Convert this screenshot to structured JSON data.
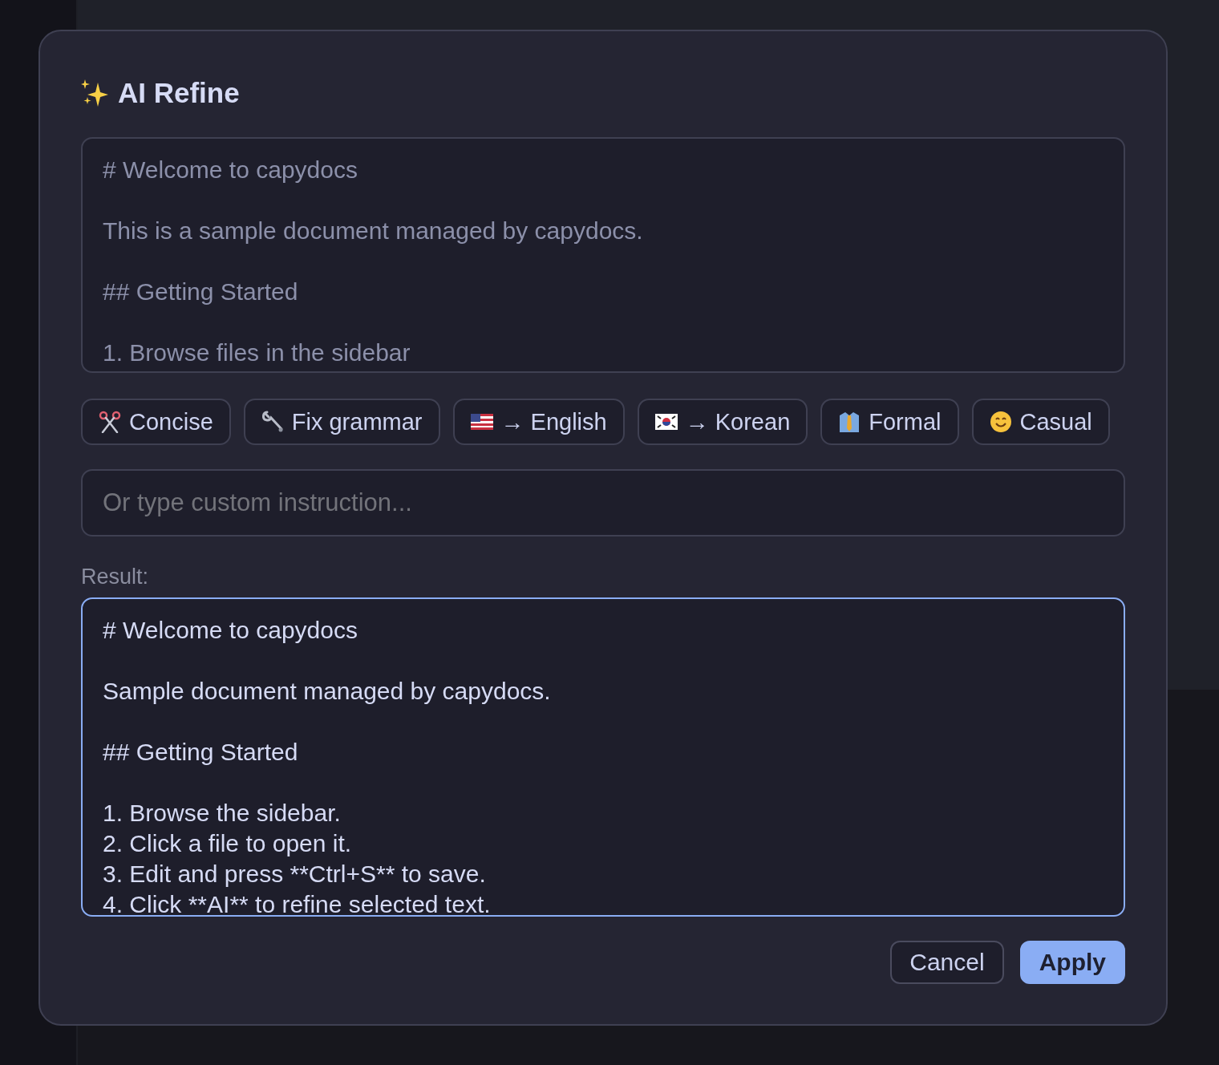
{
  "dialog": {
    "title": "AI Refine",
    "source_paragraphs": [
      [
        "# Welcome to capydocs"
      ],
      [
        "This is a sample document managed by capydocs."
      ],
      [
        "## Getting Started"
      ],
      [
        "1. Browse files in the sidebar"
      ]
    ],
    "presets": [
      {
        "label": "Concise"
      },
      {
        "label": "Fix grammar"
      },
      {
        "label": "→ English"
      },
      {
        "label": "→ Korean"
      },
      {
        "label": "Formal"
      },
      {
        "label": "Casual"
      }
    ],
    "instruction": {
      "placeholder": "Or type custom instruction..."
    },
    "result_label": "Result:",
    "result_paragraphs": [
      [
        "# Welcome to capydocs"
      ],
      [
        "Sample document managed by capydocs."
      ],
      [
        "## Getting Started"
      ],
      [
        "1. Browse the sidebar.",
        "2. Click a file to open it.",
        "3. Edit and press **Ctrl+S** to save.",
        "4. Click **AI** to refine selected text."
      ]
    ],
    "buttons": [
      {
        "label": "Cancel",
        "kind": "secondary"
      },
      {
        "label": "Apply",
        "kind": "primary"
      }
    ]
  }
}
